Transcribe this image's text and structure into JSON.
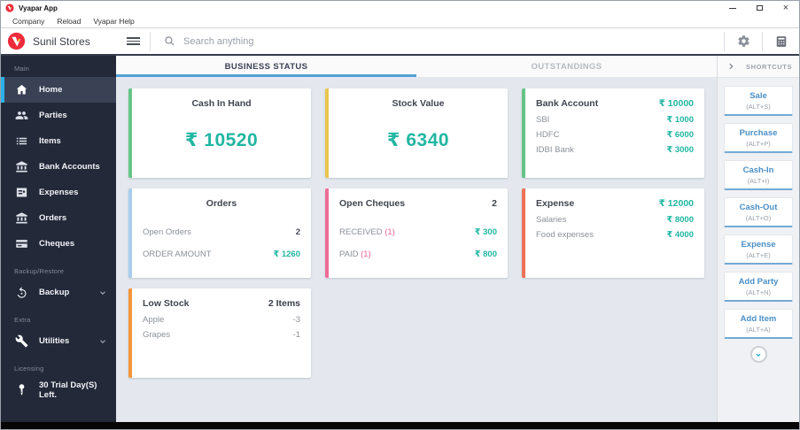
{
  "window": {
    "title": "Vyapar App"
  },
  "menu": {
    "items": [
      "Company",
      "Reload",
      "Vyapar Help"
    ]
  },
  "header": {
    "company_name": "Sunil Stores",
    "search_placeholder": "Search anything"
  },
  "sidebar": {
    "sections": {
      "main": "Main",
      "backup": "Backup/Restore",
      "extra": "Extra",
      "licensing": "Licensing"
    },
    "items": [
      {
        "label": "Home"
      },
      {
        "label": "Parties"
      },
      {
        "label": "Items"
      },
      {
        "label": "Bank Accounts"
      },
      {
        "label": "Expenses"
      },
      {
        "label": "Orders"
      },
      {
        "label": "Cheques"
      }
    ],
    "backup_item": "Backup",
    "utilities_item": "Utilities",
    "trial_item": "30 Trial Day(S) Left."
  },
  "tabs": {
    "business_status": "BUSINESS STATUS",
    "outstandings": "OUTSTANDINGS"
  },
  "cards": {
    "cash_in_hand": {
      "title": "Cash In Hand",
      "value": "₹ 10520"
    },
    "stock_value": {
      "title": "Stock Value",
      "value": "₹ 6340"
    },
    "bank_account": {
      "title": "Bank Account",
      "total": "₹ 10000",
      "rows": [
        {
          "label": "SBI",
          "value": "₹ 1000"
        },
        {
          "label": "HDFC",
          "value": "₹ 6000"
        },
        {
          "label": "IDBI Bank",
          "value": "₹ 3000"
        }
      ]
    },
    "orders": {
      "title": "Orders",
      "rows": [
        {
          "label": "Open Orders",
          "value": "2"
        },
        {
          "label": "ORDER AMOUNT",
          "value": "₹ 1260"
        }
      ]
    },
    "open_cheques": {
      "title": "Open Cheques",
      "count": "2",
      "rows": [
        {
          "label": "RECEIVED",
          "count": "(1)",
          "value": "₹ 300"
        },
        {
          "label": "PAID",
          "count": "(1)",
          "value": "₹ 800"
        }
      ]
    },
    "expense": {
      "title": "Expense",
      "total": "₹ 12000",
      "rows": [
        {
          "label": "Salaries",
          "value": "₹ 8000"
        },
        {
          "label": "Food expenses",
          "value": "₹ 4000"
        }
      ]
    },
    "low_stock": {
      "title": "Low Stock",
      "count": "2 Items",
      "rows": [
        {
          "label": "Apple",
          "value": "-3"
        },
        {
          "label": "Grapes",
          "value": "-1"
        }
      ]
    }
  },
  "shortcuts": {
    "header": "SHORTCUTS",
    "buttons": [
      {
        "label": "Sale",
        "key": "(ALT+S)"
      },
      {
        "label": "Purchase",
        "key": "(ALT+P)"
      },
      {
        "label": "Cash-In",
        "key": "(ALT+I)"
      },
      {
        "label": "Cash-Out",
        "key": "(ALT+O)"
      },
      {
        "label": "Expense",
        "key": "(ALT+E)"
      },
      {
        "label": "Add Party",
        "key": "(ALT+N)"
      },
      {
        "label": "Add Item",
        "key": "(ALT+A)"
      }
    ]
  },
  "colors": {
    "brand_red": "#ee2b3a",
    "value_teal": "#21b6a2",
    "tab_underline_blue": "#54a0d5",
    "sidebar_bg": "#232939",
    "sidebar_active_accent": "#2bb2e8",
    "accent_green": "#66c487",
    "accent_yellow": "#e9c64d",
    "accent_light_blue": "#a8cdec",
    "accent_pink": "#ee6d96",
    "accent_red_orange": "#ee7257",
    "accent_orange": "#f5953c",
    "cheque_count_pink": "#ef6292",
    "shortcut_label_blue": "#4a8fc7"
  }
}
